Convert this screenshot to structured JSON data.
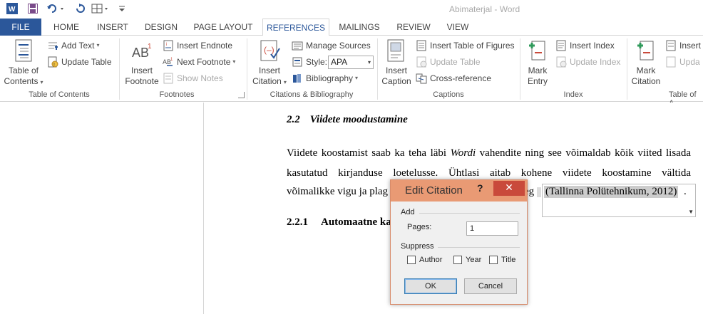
{
  "titlebar": {
    "app_title": "Abimaterjal - Word"
  },
  "tabs": [
    "FILE",
    "HOME",
    "INSERT",
    "DESIGN",
    "PAGE LAYOUT",
    "REFERENCES",
    "MAILINGS",
    "REVIEW",
    "VIEW"
  ],
  "ribbon": {
    "toc": {
      "big_label_1": "Table of",
      "big_label_2": "Contents",
      "add_text": "Add Text",
      "update_table": "Update Table",
      "group": "Table of Contents"
    },
    "footnotes": {
      "insert_footnote_1": "Insert",
      "insert_footnote_2": "Footnote",
      "insert_endnote": "Insert Endnote",
      "next_footnote": "Next Footnote",
      "show_notes": "Show Notes",
      "group": "Footnotes"
    },
    "citations": {
      "insert_citation_1": "Insert",
      "insert_citation_2": "Citation",
      "manage_sources": "Manage Sources",
      "style_label": "Style:",
      "style_value": "APA",
      "bibliography": "Bibliography",
      "group": "Citations & Bibliography"
    },
    "captions": {
      "insert_caption_1": "Insert",
      "insert_caption_2": "Caption",
      "insert_table_of_figures": "Insert Table of Figures",
      "update_table": "Update Table",
      "cross_reference": "Cross-reference",
      "group": "Captions"
    },
    "index": {
      "mark_entry_1": "Mark",
      "mark_entry_2": "Entry",
      "insert_index": "Insert Index",
      "update_index": "Update Index",
      "group": "Index"
    },
    "toa": {
      "mark_citation_1": "Mark",
      "mark_citation_2": "Citation",
      "insert_toa": "Insert T",
      "update_toa": "Upda",
      "group": "Table of A"
    }
  },
  "document": {
    "heading_22_num": "2.2",
    "heading_22_text": "Viidete moodustamine",
    "para_line1_a": "Viidete koostamist saab ka teha läbi ",
    "para_line1_word": "Wordi",
    "para_line1_b": " vahendite ning see võimaldab kõik viited lisada",
    "para_line2": "kasutatud kirjanduse loetelusse. Ühtlasi aitab kohene viidete koostamine vältida",
    "para_line3_a": "võimalikke vigu ja plag",
    "para_line3_b": "eg",
    "citation": "(Tallinna Polütehnikum, 2012)",
    "citation_after": ".",
    "heading_221_num": "2.2.1",
    "heading_221_text": "Automaatne ka"
  },
  "dialog": {
    "title": "Edit Citation",
    "help": "?",
    "close": "✕",
    "add_section": "Add",
    "pages_label": "Pages:",
    "pages_value": "1",
    "suppress_section": "Suppress",
    "author": "Author",
    "year": "Year",
    "title_opt": "Title",
    "ok": "OK",
    "cancel": "Cancel"
  },
  "colors": {
    "accent": "#2b579a",
    "dialog_titlebar": "#e99a74",
    "close_red": "#c94a3b"
  }
}
